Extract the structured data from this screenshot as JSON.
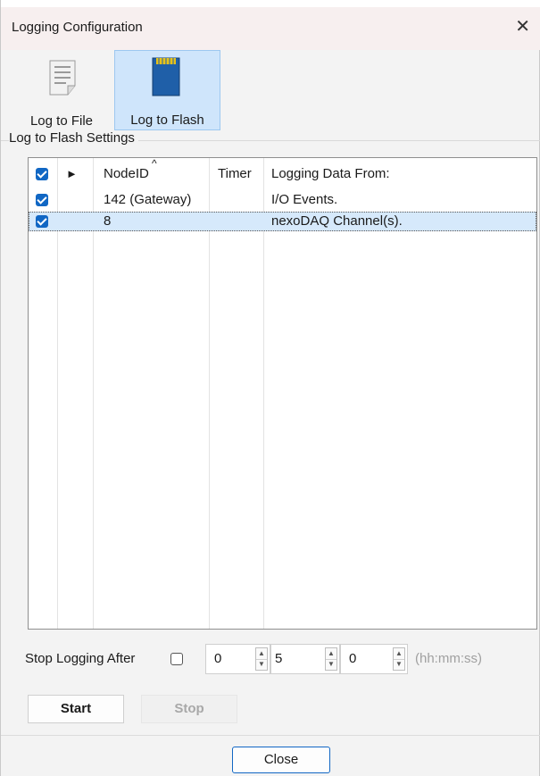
{
  "window": {
    "title": "Logging Configuration"
  },
  "toolbar": {
    "file_label": "Log to File",
    "flash_label": "Log to Flash"
  },
  "group": {
    "title": "Log to Flash Settings"
  },
  "table": {
    "headers": {
      "expand": "►",
      "node_id": "NodeID",
      "timer": "Timer",
      "logging_from": "Logging Data From:"
    },
    "sort_indicator": "^",
    "rows": [
      {
        "checked": true,
        "node_id": "142 (Gateway)",
        "timer": "",
        "logging_from": "I/O Events.",
        "selected": false
      },
      {
        "checked": true,
        "node_id": "8",
        "timer": "",
        "logging_from": "nexoDAQ Channel(s).",
        "selected": true
      }
    ]
  },
  "stop_after": {
    "label": "Stop Logging After",
    "checked": false,
    "hours": "0",
    "minutes": "5",
    "seconds": "0",
    "format_hint": "(hh:mm:ss)"
  },
  "buttons": {
    "start": "Start",
    "stop": "Stop",
    "close": "Close"
  },
  "colors": {
    "accent": "#1167c4",
    "selection": "#d6e9fb",
    "selected_tool": "#cfe5fb"
  }
}
